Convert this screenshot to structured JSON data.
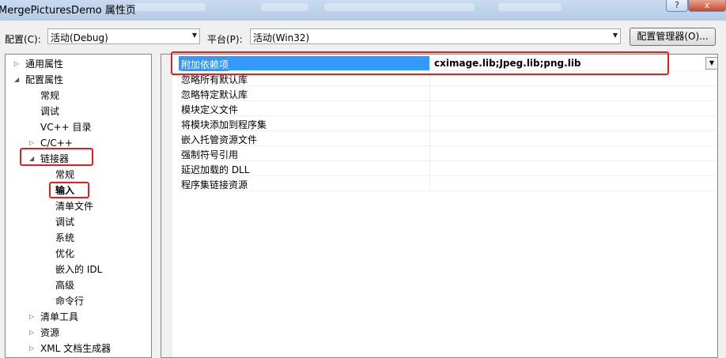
{
  "window": {
    "title": "MergePicturesDemo 属性页",
    "help_label": "?",
    "close_label": "x"
  },
  "toolbar": {
    "config_label": "配置(C):",
    "config_value": "活动(Debug)",
    "platform_label": "平台(P):",
    "platform_value": "活动(Win32)",
    "config_manager_label": "配置管理器(O)..."
  },
  "tree": [
    {
      "label": "通用属性",
      "expander": "▷"
    },
    {
      "label": "配置属性",
      "expander": "◢"
    },
    {
      "label": "常规",
      "expander": ""
    },
    {
      "label": "调试",
      "expander": ""
    },
    {
      "label": "VC++ 目录",
      "expander": ""
    },
    {
      "label": "C/C++",
      "expander": "▷"
    },
    {
      "label": "链接器",
      "expander": "◢"
    },
    {
      "label": "常规",
      "expander": ""
    },
    {
      "label": "输入",
      "expander": ""
    },
    {
      "label": "清单文件",
      "expander": ""
    },
    {
      "label": "调试",
      "expander": ""
    },
    {
      "label": "系统",
      "expander": ""
    },
    {
      "label": "优化",
      "expander": ""
    },
    {
      "label": "嵌入的 IDL",
      "expander": ""
    },
    {
      "label": "高级",
      "expander": ""
    },
    {
      "label": "命令行",
      "expander": ""
    },
    {
      "label": "清单工具",
      "expander": "▷"
    },
    {
      "label": "资源",
      "expander": "▷"
    },
    {
      "label": "XML 文档生成器",
      "expander": "▷"
    }
  ],
  "properties": [
    {
      "name": "附加依赖项",
      "value": "cximage.lib;Jpeg.lib;png.lib"
    },
    {
      "name": "忽略所有默认库",
      "value": ""
    },
    {
      "name": "忽略特定默认库",
      "value": ""
    },
    {
      "name": "模块定义文件",
      "value": ""
    },
    {
      "name": "将模块添加到程序集",
      "value": ""
    },
    {
      "name": "嵌入托管资源文件",
      "value": ""
    },
    {
      "name": "强制符号引用",
      "value": ""
    },
    {
      "name": "延迟加载的 DLL",
      "value": ""
    },
    {
      "name": "程序集链接资源",
      "value": ""
    }
  ],
  "colors": {
    "selection": "#3399ff",
    "highlight_box": "#e61e1e"
  }
}
